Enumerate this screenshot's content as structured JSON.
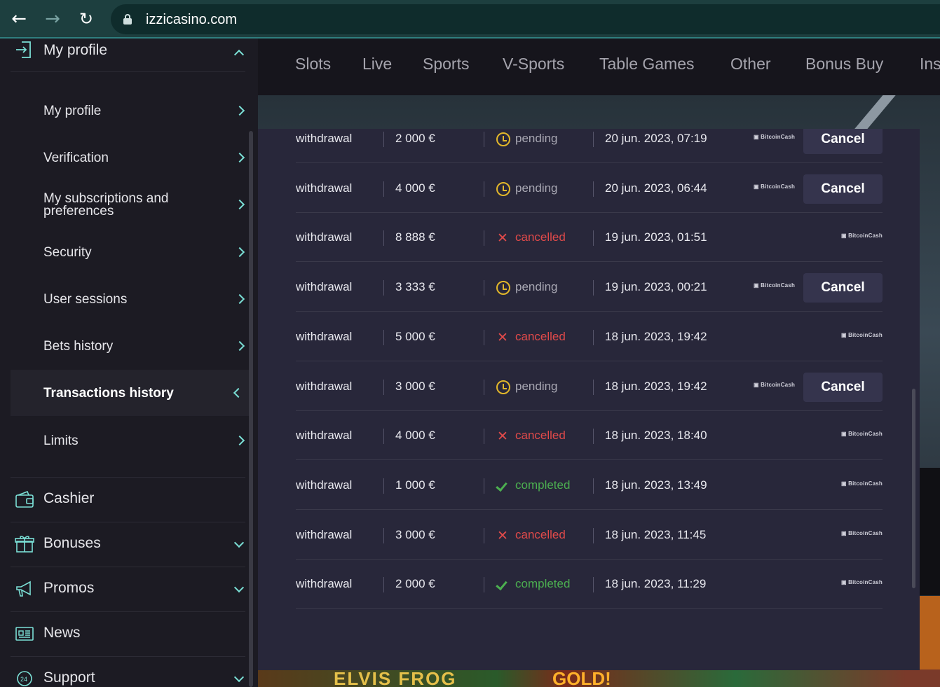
{
  "browser": {
    "url": "izzicasino.com",
    "back_icon": "arrow-left-icon",
    "forward_icon": "arrow-right-icon",
    "reload_icon": "reload-icon"
  },
  "sidebar": {
    "header": {
      "label": "My profile",
      "icon": "login-icon"
    },
    "sub_items": [
      {
        "label": "My profile"
      },
      {
        "label": "Verification"
      },
      {
        "label": "My subscriptions and preferences"
      },
      {
        "label": "Security"
      },
      {
        "label": "User sessions"
      },
      {
        "label": "Bets history"
      },
      {
        "label": "Transactions history",
        "active": true
      },
      {
        "label": "Limits"
      }
    ],
    "main_items": [
      {
        "label": "Cashier",
        "icon": "wallet-icon"
      },
      {
        "label": "Bonuses",
        "icon": "gift-icon"
      },
      {
        "label": "Promos",
        "icon": "megaphone-icon"
      },
      {
        "label": "News",
        "icon": "newspaper-icon"
      },
      {
        "label": "Support",
        "icon": "support-24-icon"
      }
    ]
  },
  "topnav": {
    "tabs": [
      "Slots",
      "Live",
      "Sports",
      "V-Sports",
      "Table Games",
      "Other",
      "Bonus Buy",
      "Ins"
    ]
  },
  "background": {
    "game_title_1": "ELVIS FROG",
    "game_title_2": "GOLD!"
  },
  "transactions": {
    "cancel_label": "Cancel",
    "rows": [
      {
        "type": "withdrawal",
        "amount": "2 000 €",
        "status": "pending",
        "date": "20 jun. 2023, 07:19",
        "method": "BitcoinCash",
        "cancelable": true
      },
      {
        "type": "withdrawal",
        "amount": "4 000 €",
        "status": "pending",
        "date": "20 jun. 2023, 06:44",
        "method": "BitcoinCash",
        "cancelable": true
      },
      {
        "type": "withdrawal",
        "amount": "8 888 €",
        "status": "cancelled",
        "date": "19 jun. 2023, 01:51",
        "method": "BitcoinCash",
        "cancelable": false
      },
      {
        "type": "withdrawal",
        "amount": "3 333 €",
        "status": "pending",
        "date": "19 jun. 2023, 00:21",
        "method": "BitcoinCash",
        "cancelable": true
      },
      {
        "type": "withdrawal",
        "amount": "5 000 €",
        "status": "cancelled",
        "date": "18 jun. 2023, 19:42",
        "method": "BitcoinCash",
        "cancelable": false
      },
      {
        "type": "withdrawal",
        "amount": "3 000 €",
        "status": "pending",
        "date": "18 jun. 2023, 19:42",
        "method": "BitcoinCash",
        "cancelable": true
      },
      {
        "type": "withdrawal",
        "amount": "4 000 €",
        "status": "cancelled",
        "date": "18 jun. 2023, 18:40",
        "method": "BitcoinCash",
        "cancelable": false
      },
      {
        "type": "withdrawal",
        "amount": "1 000 €",
        "status": "completed",
        "date": "18 jun. 2023, 13:49",
        "method": "BitcoinCash",
        "cancelable": false
      },
      {
        "type": "withdrawal",
        "amount": "3 000 €",
        "status": "cancelled",
        "date": "18 jun. 2023, 11:45",
        "method": "BitcoinCash",
        "cancelable": false
      },
      {
        "type": "withdrawal",
        "amount": "2 000 €",
        "status": "completed",
        "date": "18 jun. 2023, 11:29",
        "method": "BitcoinCash",
        "cancelable": false
      }
    ]
  },
  "colors": {
    "accent": "#7be0d6",
    "pending": "#e2b72a",
    "cancelled": "#e04a4a",
    "completed": "#4caf50"
  }
}
